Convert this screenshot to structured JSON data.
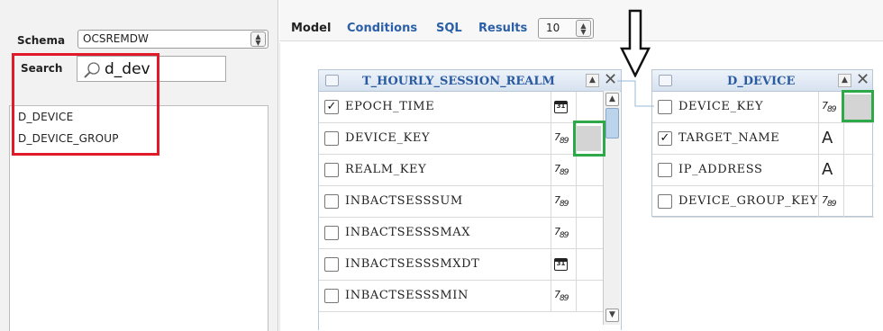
{
  "sidebar": {
    "schema_label": "Schema",
    "schema_value": "OCSREMDW",
    "search_label": "Search",
    "search_value": "d_dev",
    "results": [
      "D_DEVICE",
      "D_DEVICE_GROUP"
    ]
  },
  "tabs": {
    "model": "Model",
    "conditions": "Conditions",
    "sql": "SQL",
    "results": "Results",
    "results_count": "10"
  },
  "tables": [
    {
      "title": "T_HOURLY_SESSION_REALM",
      "columns": [
        {
          "name": "EPOCH_TIME",
          "checked": true,
          "type": "date"
        },
        {
          "name": "DEVICE_KEY",
          "checked": false,
          "type": "number"
        },
        {
          "name": "REALM_KEY",
          "checked": false,
          "type": "number"
        },
        {
          "name": "INBACTSESSSUM",
          "checked": false,
          "type": "number"
        },
        {
          "name": "INBACTSESSSMAX",
          "checked": false,
          "type": "number"
        },
        {
          "name": "INBACTSESSSMXDT",
          "checked": false,
          "type": "date"
        },
        {
          "name": "INBACTSESSSMIN",
          "checked": false,
          "type": "number"
        }
      ]
    },
    {
      "title": "D_DEVICE",
      "columns": [
        {
          "name": "DEVICE_KEY",
          "checked": false,
          "type": "number"
        },
        {
          "name": "TARGET_NAME",
          "checked": true,
          "type": "text"
        },
        {
          "name": "IP_ADDRESS",
          "checked": false,
          "type": "text"
        },
        {
          "name": "DEVICE_GROUP_KEY",
          "checked": false,
          "type": "number"
        }
      ]
    }
  ],
  "glyphs": {
    "checked": "✓",
    "num_main": "7",
    "num_sub": "89",
    "date": "31",
    "text": "A",
    "spin_up": "▲",
    "spin_down": "▼",
    "minimize": "▲",
    "close": "✕"
  },
  "colors": {
    "link_blue": "#2b5fa8",
    "red_highlight": "#e11a2a",
    "green_highlight": "#2fa84a",
    "header_title": "#2a5aa0"
  }
}
